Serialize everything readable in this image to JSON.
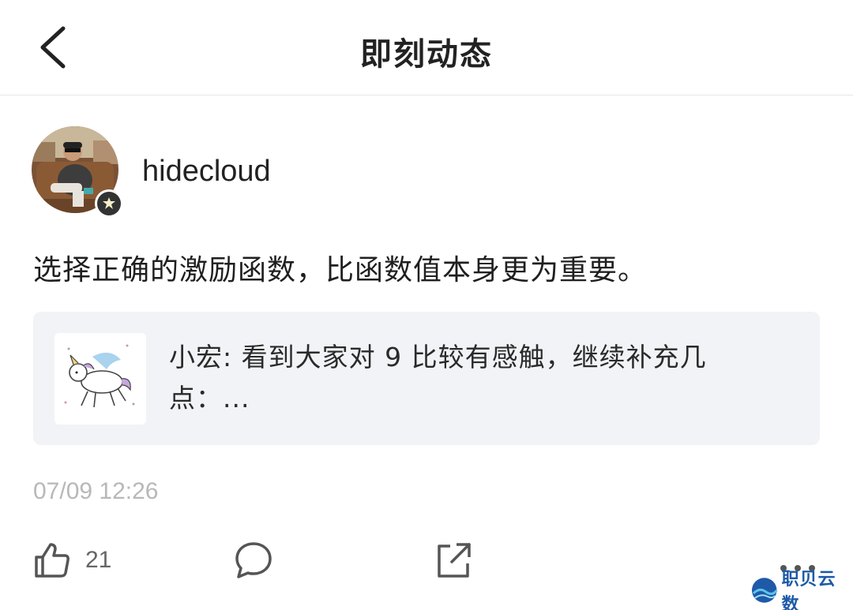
{
  "header": {
    "title": "即刻动态",
    "back_icon": "chevron-left-icon"
  },
  "post": {
    "author": {
      "username": "hidecloud",
      "badge_icon": "verified-badge-icon"
    },
    "text": "选择正确的激励函数，比函数值本身更为重要。",
    "quote": {
      "line1": "小宏: 看到大家对 9 比较有感触，继续补充几",
      "line2": "点：..."
    },
    "timestamp": "07/09 12:26",
    "actions": {
      "like_count": "21",
      "like_icon": "thumbs-up-icon",
      "comment_icon": "comment-bubble-icon",
      "share_icon": "share-icon",
      "more_icon": "more-dots-icon"
    }
  },
  "watermark": {
    "text": "职贝云数"
  },
  "colors": {
    "text_primary": "#1f1f1f",
    "text_muted": "#b8b8b8",
    "card_bg": "#f1f3f6",
    "watermark": "#1e5aa8"
  }
}
